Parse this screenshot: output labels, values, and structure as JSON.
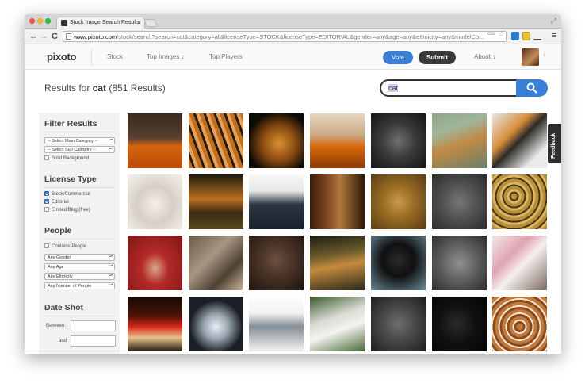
{
  "browser": {
    "tab_title": "Stock Image Search Results",
    "tab_close": "×",
    "url_prefix": "www.pixoto.com",
    "url_rest": "/stock/search?search=cat&category=all&licenseType=STOCK&licenseType=EDITORIAL&gender=any&age=any&ethnicity=any&modelCo...",
    "css_indicator": "css",
    "back": "←",
    "forward": "→",
    "reload": "C",
    "star": "☆",
    "menu": "≡",
    "fullscreen": "⤢"
  },
  "site": {
    "logo": "pixoto",
    "nav": [
      "Stock",
      "Top Images ↕",
      "Top Players"
    ],
    "vote_label": "Vote",
    "submit_label": "Submit",
    "about_label": "About ↕",
    "avatar_caret": "↕"
  },
  "results": {
    "prefix": "Results for ",
    "term": "cat",
    "count_text": " (851 Results)"
  },
  "search": {
    "value": "cat",
    "icon": "search-icon"
  },
  "filters": {
    "title": "Filter Results",
    "main_category": "-- Select Main Category --",
    "sub_category": "-- Select Sub Category --",
    "solid_background": "Solid Background",
    "license_title": "License Type",
    "license_options": [
      {
        "label": "Stock/Commercial",
        "checked": true
      },
      {
        "label": "Editorial",
        "checked": true
      },
      {
        "label": "Embed/Blog (free)",
        "checked": false
      }
    ],
    "people_title": "People",
    "contains_people": "Contains People",
    "gender": "Any Gender",
    "age": "Any Age",
    "ethnicity": "Any Ethnicity",
    "num_people": "Any Number of People",
    "date_title": "Date Shot",
    "between_label": "Between:",
    "and_label": "and"
  },
  "feedback_label": "Feedback",
  "grid": {
    "columns": 7,
    "tiles": [
      {
        "name": "cat-on-pumpkins",
        "bg": "linear-gradient(180deg,#3a2a1e 0%,#5a4030 45%,#d8650e 60%,#b94a05 100%)"
      },
      {
        "name": "tiger-closeup",
        "bg": "repeating-linear-gradient(70deg,#c06f1c 0 5px,#2b1a0c 5px 8px,#e5a25a 8px 12px)"
      },
      {
        "name": "tiger-cub-lying",
        "bg": "radial-gradient(ellipse at 55% 55%,#d98f30 0,#8a4a10 40%,#0c0a06 75%)"
      },
      {
        "name": "pumpkins-on-table",
        "bg": "linear-gradient(180deg,#e8d6c0 0%,#c9a884 40%,#d9680c 60%,#8a3b05 100%)"
      },
      {
        "name": "gray-cat-face",
        "bg": "radial-gradient(circle at 50% 50%,#6f6f6f 0,#3a3a3a 45%,#151515 100%)"
      },
      {
        "name": "tiger-in-water",
        "bg": "linear-gradient(160deg,#8fa78e 0%,#a0b59a 30%,#c08a45 55%,#6c7e6b 100%)"
      },
      {
        "name": "tigers-in-snow",
        "bg": "linear-gradient(135deg,#e7e7e4 0%,#d78e3c 35%,#2c2a25 50%,#eaeaea 80%)"
      },
      {
        "name": "white-kitten",
        "bg": "radial-gradient(circle at 50% 55%,#f3efea 0,#d7cfc5 45%,#f4f2ef 100%)"
      },
      {
        "name": "tiger-walking",
        "bg": "linear-gradient(180deg,#1d1c10 0%,#b9701f 45%,#3b2a12 70%,#5b4a1f 100%)"
      },
      {
        "name": "cat-in-boot",
        "bg": "linear-gradient(180deg,#f8f8f8 0%,#e6e6e6 30%,#2d3540 55%,#19212c 100%)"
      },
      {
        "name": "cat-bookshelf",
        "bg": "linear-gradient(90deg,#3b1d0f 0%,#7d4420 30%,#b07a3c 55%,#2a160a 100%)"
      },
      {
        "name": "leopard-face",
        "bg": "radial-gradient(circle at 50% 50%,#c99a4a 0,#9a6e25 40%,#5b3d15 100%)"
      },
      {
        "name": "gray-cat-yellow-eyes",
        "bg": "radial-gradient(circle at 50% 50%,#777 0,#555 40%,#2b2b2b 100%)"
      },
      {
        "name": "leopard-closeup",
        "bg": "repeating-radial-gradient(circle at 40% 40%,#b88e3a 0 4px,#4a3410 4px 6px,#d8b665 6px 9px)"
      },
      {
        "name": "cat-in-red-blanket",
        "bg": "radial-gradient(ellipse at 50% 60%,#d7a58a 0,#b42a28 35%,#7e1616 100%)"
      },
      {
        "name": "tabby-eye-closeup",
        "bg": "linear-gradient(135deg,#6a5a4a 0%,#a89682 40%,#4d4133 70%,#cbb69c 100%)"
      },
      {
        "name": "brown-kitten",
        "bg": "radial-gradient(circle at 50% 45%,#6c5040 0,#4a3428 40%,#1e140e 100%)"
      },
      {
        "name": "tiger-in-grass",
        "bg": "linear-gradient(170deg,#1a1b12 0%,#6b5b2b 35%,#c58a3e 55%,#2a2a1a 100%)"
      },
      {
        "name": "black-cat",
        "bg": "radial-gradient(circle at 50% 45%,#2a2a2a 0,#101010 40%,#6a8a9a 100%)"
      },
      {
        "name": "gray-cat-pink-nose",
        "bg": "radial-gradient(circle at 50% 50%,#8d8f91 0,#5f6163 45%,#2a2b2d 100%)"
      },
      {
        "name": "kittens-with-sock",
        "bg": "linear-gradient(135deg,#f1e8e4 0%,#e0a4b4 35%,#f6f0ee 55%,#7a6a60 100%)"
      },
      {
        "name": "kitten-santa-hat",
        "bg": "linear-gradient(180deg,#170905 0%,#4b1407 35%,#d4281a 55%,#e7c38a 75%,#2a1a10 100%)"
      },
      {
        "name": "white-kitten-hood",
        "bg": "radial-gradient(circle at 50% 55%,#e9eef3 0,#9aa6b1 30%,#1b1e24 65%)"
      },
      {
        "name": "gray-kitten-lying",
        "bg": "linear-gradient(180deg,#fdfdfd 0%,#f2f2f2 30%,#858f96 55%,#f4f4f4 100%)"
      },
      {
        "name": "white-tiger",
        "bg": "linear-gradient(160deg,#3a5a2a 0%,#dcdcd6 40%,#f3f3ef 60%,#4a6a3a 100%)"
      },
      {
        "name": "gray-cat-green-eyes",
        "bg": "radial-gradient(circle at 50% 50%,#6e6e6e 0,#474747 45%,#1e1e1e 100%)"
      },
      {
        "name": "black-cat-dark",
        "bg": "radial-gradient(circle at 45% 50%,#2b2b2b 0,#111 45%,#050505 100%)"
      },
      {
        "name": "cat-in-basket",
        "bg": "repeating-radial-gradient(circle at 50% 55%,#c27a3a 0 4px,#8a4b1e 4px 7px,#f2e4d0 7px 9px)"
      }
    ]
  }
}
